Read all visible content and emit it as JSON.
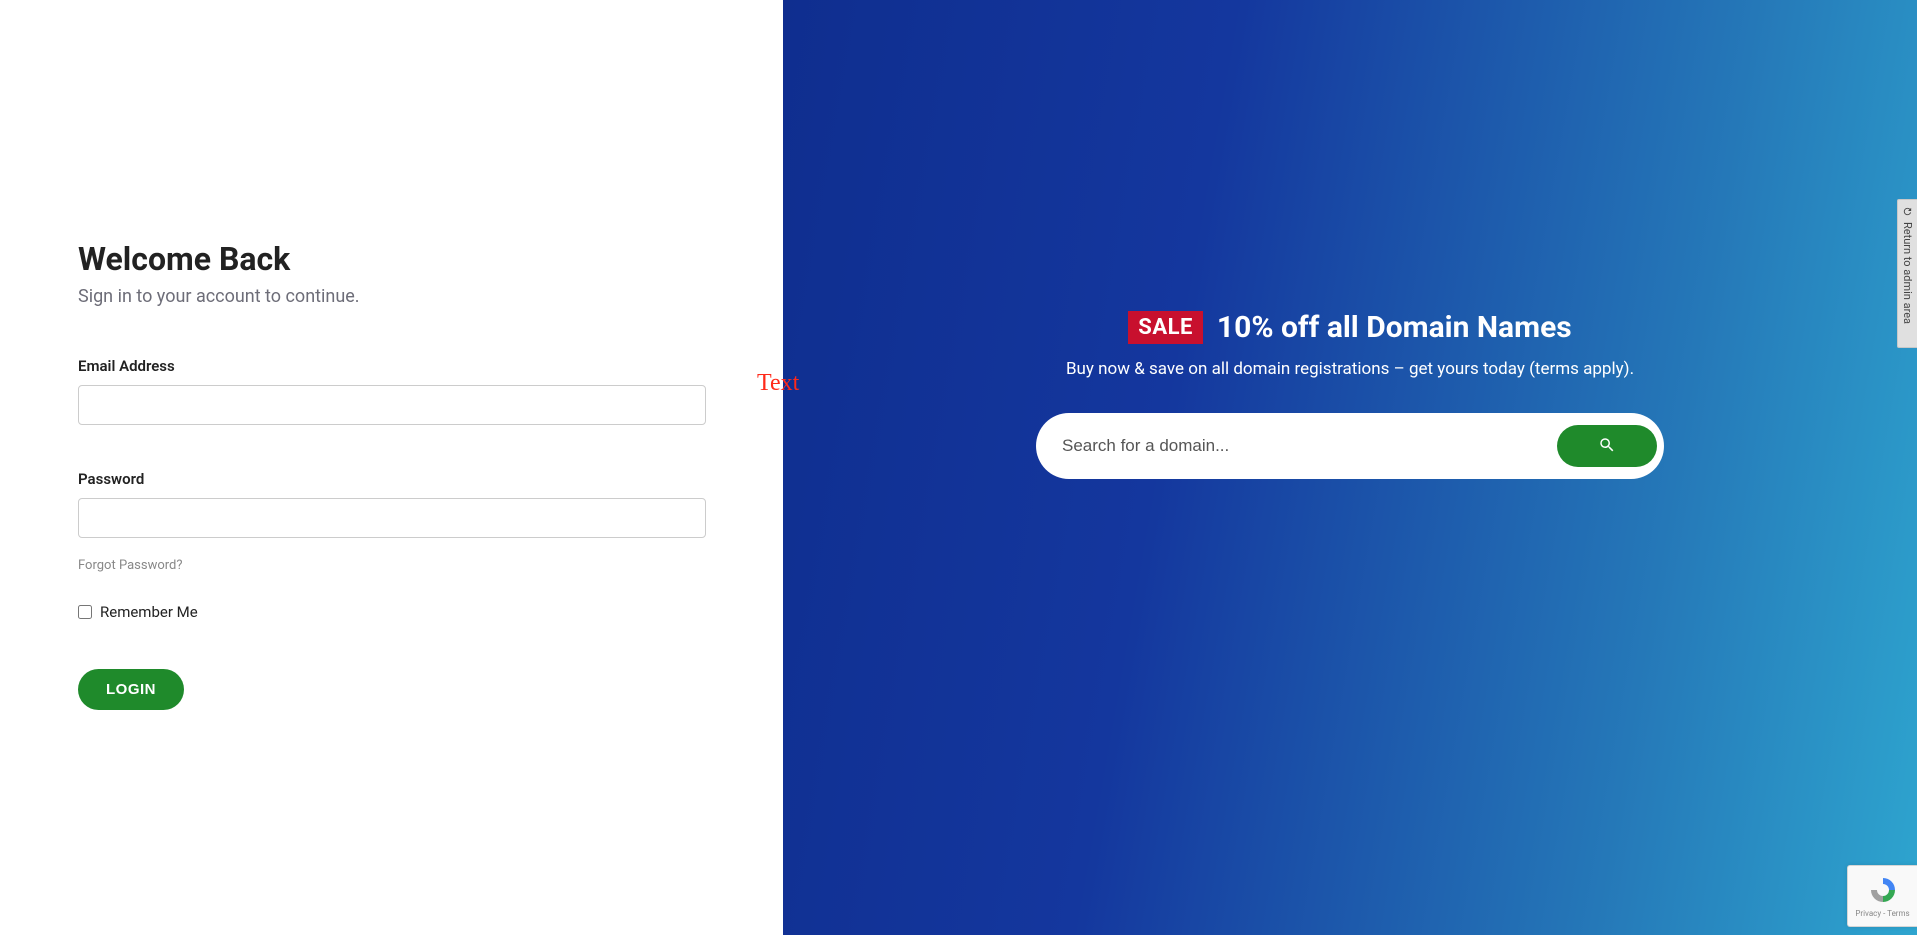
{
  "left": {
    "title": "Welcome Back",
    "subtitle": "Sign in to your account to continue.",
    "email_label": "Email Address",
    "password_label": "Password",
    "forgot": "Forgot Password?",
    "remember": "Remember Me",
    "login_button": "LOGIN"
  },
  "overlay": {
    "text": "Text"
  },
  "right": {
    "sale_badge": "SALE",
    "promo_title": "10% off all Domain Names",
    "promo_subtitle": "Buy now & save on all domain registrations – get yours today (terms apply).",
    "search_placeholder": "Search for a domain..."
  },
  "sidebar": {
    "return_label": "Return to admin area"
  },
  "recaptcha": {
    "line": "Privacy - Terms"
  }
}
